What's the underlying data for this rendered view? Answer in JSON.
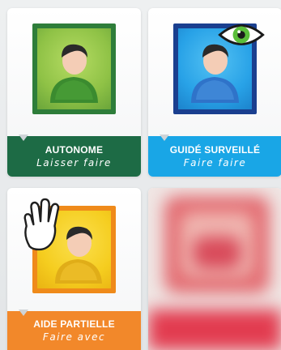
{
  "cards": [
    {
      "title": "AUTONOME",
      "subtitle": "Laisser faire",
      "icon": "person-icon",
      "colors": {
        "frame": "#2e7d3a",
        "bg": "#92c64a",
        "body": "#3f8f30",
        "banner": "#1d6b45"
      }
    },
    {
      "title": "GUIDÉ SURVEILLÉ",
      "subtitle": "Faire faire",
      "icon": "person-with-eye-icon",
      "colors": {
        "frame": "#1a3f8f",
        "bg": "#29a3e8",
        "body": "#2b6fc2",
        "banner": "#19a6e6"
      }
    },
    {
      "title": "AIDE PARTIELLE",
      "subtitle": "Faire avec",
      "icon": "person-with-hand-icon",
      "colors": {
        "frame": "#ef8a1a",
        "bg": "#f5d11f",
        "body": "#e3b21b",
        "banner": "#f2882a"
      }
    },
    {
      "title": "",
      "subtitle": "",
      "icon": "blurred-card",
      "colors": {
        "frame": "#e25b68",
        "bg": "#f2c6c4",
        "body": "#e04656",
        "banner": "#e8384b"
      }
    }
  ]
}
